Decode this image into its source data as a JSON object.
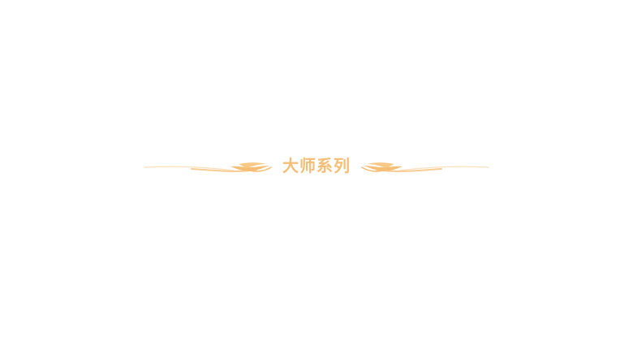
{
  "section": {
    "title": "大师系列",
    "accent_color": "#f6bd74",
    "ornament_icon": "flourish-divider"
  }
}
